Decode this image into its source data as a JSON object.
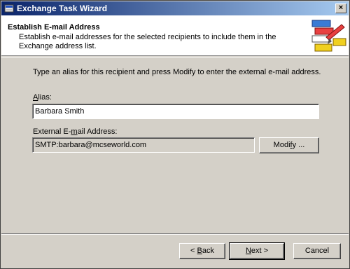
{
  "window": {
    "title": "Exchange Task Wizard",
    "close_label": "×"
  },
  "header": {
    "title": "Establish E-mail Address",
    "description_line1": "Establish e-mail addresses for the selected recipients to include them in the",
    "description_line2": "Exchange address list."
  },
  "body": {
    "instruction": "Type an alias for this recipient and press Modify to enter the external e-mail address.",
    "alias": {
      "label_accel": "A",
      "label_rest": "lias:",
      "value": "Barbara Smith"
    },
    "external": {
      "label_pre": "External E-",
      "label_accel": "m",
      "label_rest": "ail Address:",
      "value": "SMTP:barbara@mcseworld.com"
    },
    "modify_button": {
      "pre": "Modi",
      "accel": "f",
      "rest": "y ..."
    }
  },
  "footer": {
    "back": {
      "pre": "< ",
      "accel": "B",
      "rest": "ack"
    },
    "next": {
      "accel": "N",
      "rest": "ext >"
    },
    "cancel": "Cancel"
  }
}
